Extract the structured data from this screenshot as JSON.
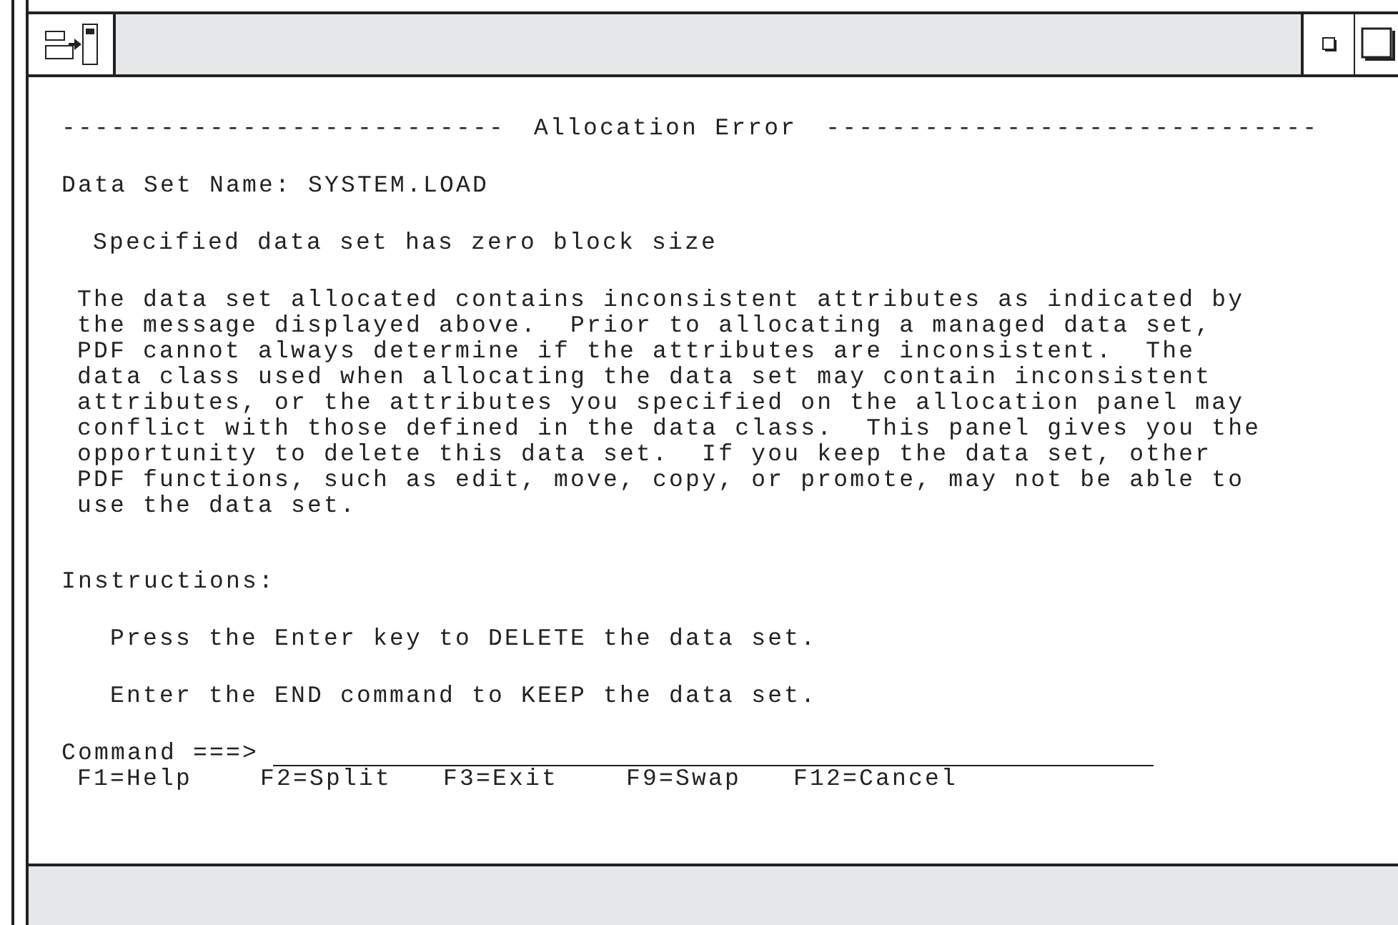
{
  "header": {
    "left_rule": "---------------------------",
    "title": "Allocation Error",
    "right_rule": "------------------------------"
  },
  "data_set_name": "Data Set Name: SYSTEM.LOAD",
  "short_message": "Specified data set has zero block size",
  "long_message_lines": [
    "The data set allocated contains inconsistent attributes as indicated by",
    "the message displayed above.  Prior to allocating a managed data set,",
    "PDF cannot always determine if the attributes are inconsistent.  The",
    "data class used when allocating the data set may contain inconsistent",
    "attributes, or the attributes you specified on the allocation panel may",
    "conflict with those defined in the data class.  This panel gives you the",
    "opportunity to delete this data set.  If you keep the data set, other",
    "PDF functions, such as edit, move, copy, or promote, may not be able to",
    "use the data set."
  ],
  "instructions_label": "Instructions:",
  "instructions": [
    "Press the Enter key to DELETE the data set.",
    "Enter the END command to KEEP the data set."
  ],
  "command": {
    "label": "Command ===>"
  },
  "function_keys": [
    "F1=Help",
    "F2=Split",
    "F3=Exit",
    "F9=Swap",
    "F12=Cancel"
  ]
}
